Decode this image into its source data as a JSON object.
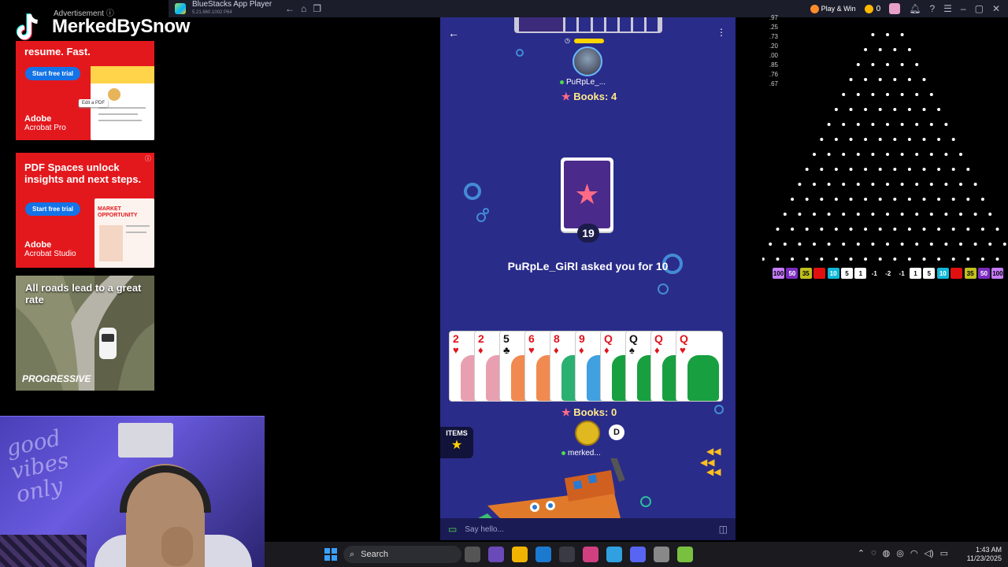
{
  "overlay": {
    "advertisement_label": "Advertisement ⓘ",
    "streamer_name": "MerkedBySnow"
  },
  "ads": [
    {
      "headline": "resume. Fast.",
      "cta": "Start free trial",
      "doc_caption": "Edit a PDF",
      "brand_line1": "Adobe",
      "brand_line2": "Acrobat Pro"
    },
    {
      "headline": "PDF Spaces unlock insights and next steps.",
      "cta": "Start free trial",
      "doc_caption": "MARKET OPPORTUNITY",
      "brand_line1": "Adobe",
      "brand_line2": "Acrobat Studio"
    },
    {
      "headline": "All roads lead to a great rate",
      "brand": "PROGRESSIVE"
    }
  ],
  "titlebar": {
    "app_title": "BlueStacks App Player",
    "app_subtitle": "5.21.660.1002 P64",
    "play_win": "Play & Win",
    "coins": "0"
  },
  "game": {
    "opponent_name": "PuRpLe_...",
    "opponent_books": "Books: 4",
    "deck_count": "19",
    "message": "PuRpLe_GiRl asked you for 10",
    "hand": [
      {
        "rank": "2",
        "suit": "♥",
        "color": "red"
      },
      {
        "rank": "2",
        "suit": "♦",
        "color": "red"
      },
      {
        "rank": "5",
        "suit": "♣",
        "color": "blk"
      },
      {
        "rank": "6",
        "suit": "♥",
        "color": "red"
      },
      {
        "rank": "8",
        "suit": "♦",
        "color": "red"
      },
      {
        "rank": "9",
        "suit": "♦",
        "color": "red"
      },
      {
        "rank": "Q",
        "suit": "♦",
        "color": "red"
      },
      {
        "rank": "Q",
        "suit": "♠",
        "color": "blk"
      },
      {
        "rank": "Q",
        "suit": "♦",
        "color": "red"
      },
      {
        "rank": "Q",
        "suit": "♥",
        "color": "red"
      }
    ],
    "my_books": "Books: 0",
    "dealer_badge": "D",
    "my_name": "merked...",
    "items_label": "ITEMS",
    "chat_placeholder": "Say hello..."
  },
  "plinko": {
    "recent": [
      ".97",
      ".25",
      ".73",
      ".20",
      ".00",
      ".85",
      ".76",
      ".67"
    ],
    "slots": [
      {
        "label": "100",
        "color": "#c77dff",
        "text": "#000"
      },
      {
        "label": "50",
        "color": "#7b2cbf",
        "text": "#fff"
      },
      {
        "label": "35",
        "color": "#c0c020",
        "text": "#000"
      },
      {
        "label": "20",
        "color": "#e01010",
        "text": "#e01010"
      },
      {
        "label": "10",
        "color": "#10b8d8",
        "text": "#fff"
      },
      {
        "label": "5",
        "color": "#ffffff",
        "text": "#000"
      },
      {
        "label": "1",
        "color": "#ffffff",
        "text": "#000"
      },
      {
        "label": "-1",
        "color": "#000000",
        "text": "#fff"
      },
      {
        "label": "-2",
        "color": "#000000",
        "text": "#fff"
      },
      {
        "label": "-1",
        "color": "#000000",
        "text": "#fff"
      },
      {
        "label": "1",
        "color": "#ffffff",
        "text": "#000"
      },
      {
        "label": "5",
        "color": "#ffffff",
        "text": "#000"
      },
      {
        "label": "10",
        "color": "#10b8d8",
        "text": "#fff"
      },
      {
        "label": "20",
        "color": "#e01010",
        "text": "#e01010"
      },
      {
        "label": "35",
        "color": "#c0c020",
        "text": "#000"
      },
      {
        "label": "50",
        "color": "#7b2cbf",
        "text": "#fff"
      },
      {
        "label": "100",
        "color": "#c77dff",
        "text": "#000"
      }
    ]
  },
  "taskbar": {
    "search_label": "Search",
    "time": "1:43 AM",
    "date": "11/23/2025"
  },
  "colors": {
    "game_bg": "#2a2c8a",
    "books_text": "#ffe98a",
    "adobe_red": "#e3181d"
  }
}
